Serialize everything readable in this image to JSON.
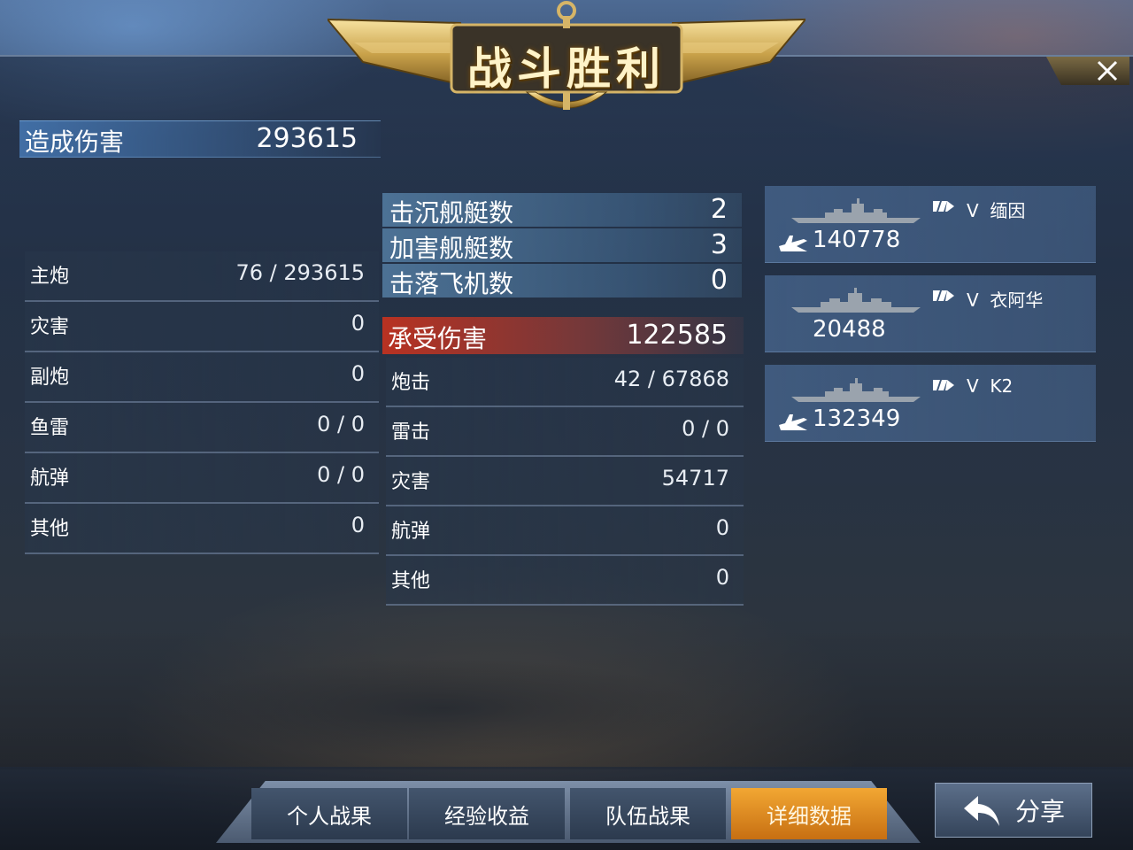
{
  "title": "战斗胜利",
  "damage_dealt": {
    "label": "造成伤害",
    "value": "293615"
  },
  "damage_breakdown": [
    {
      "label": "主炮",
      "value": "76 / 293615"
    },
    {
      "label": "灾害",
      "value": "0"
    },
    {
      "label": "副炮",
      "value": "0"
    },
    {
      "label": "鱼雷",
      "value": "0 / 0"
    },
    {
      "label": "航弹",
      "value": "0 / 0"
    },
    {
      "label": "其他",
      "value": "0"
    }
  ],
  "summary": [
    {
      "label": "击沉舰艇数",
      "value": "2"
    },
    {
      "label": "加害舰艇数",
      "value": "3"
    },
    {
      "label": "击落飞机数",
      "value": "0"
    }
  ],
  "damage_taken": {
    "label": "承受伤害",
    "value": "122585"
  },
  "taken_breakdown": [
    {
      "label": "炮击",
      "value": "42 / 67868"
    },
    {
      "label": "雷击",
      "value": "0 / 0"
    },
    {
      "label": "灾害",
      "value": "54717"
    },
    {
      "label": "航弹",
      "value": "0"
    },
    {
      "label": "其他",
      "value": "0"
    }
  ],
  "enemies": [
    {
      "rank": "V",
      "name": "缅因",
      "score": "140778",
      "icon": "plane-icon"
    },
    {
      "rank": "V",
      "name": "衣阿华",
      "score": "20488",
      "icon": ""
    },
    {
      "rank": "V",
      "name": "K2",
      "score": "132349",
      "icon": "plane-icon"
    }
  ],
  "tabs": [
    {
      "label": "个人战果",
      "active": false
    },
    {
      "label": "经验收益",
      "active": false
    },
    {
      "label": "队伍战果",
      "active": false
    },
    {
      "label": "详细数据",
      "active": true
    }
  ],
  "share_label": "分享",
  "colors": {
    "accent_gold": "#c9a24a",
    "active_tab": "#e8922a",
    "taken_red": "#c8341e",
    "panel_blue": "#46648c"
  }
}
